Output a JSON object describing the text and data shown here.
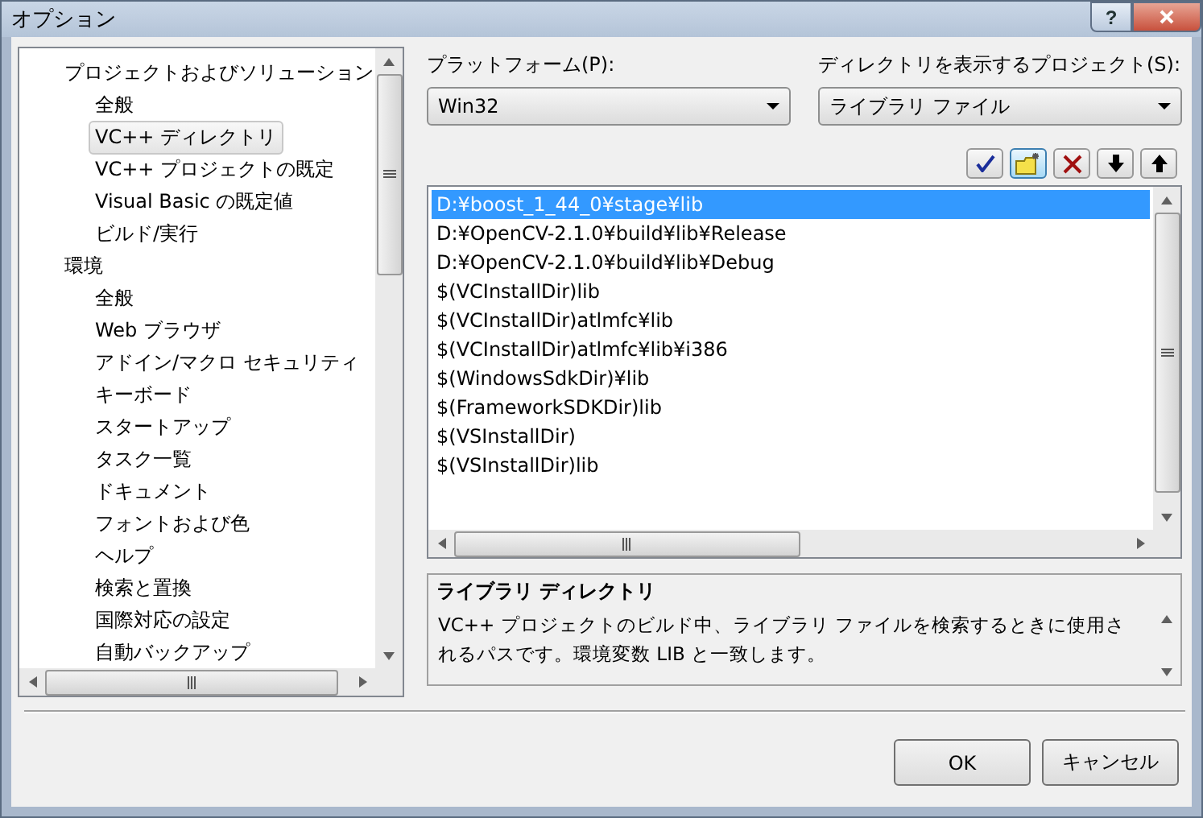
{
  "window": {
    "title": "オプション",
    "help": "?"
  },
  "tree": [
    {
      "label": "プロジェクトおよびソリューション",
      "selected": false,
      "children": [
        {
          "label": "全般",
          "selected": false
        },
        {
          "label": "VC++ ディレクトリ",
          "selected": true
        },
        {
          "label": "VC++ プロジェクトの既定",
          "selected": false
        },
        {
          "label": "Visual Basic の既定値",
          "selected": false
        },
        {
          "label": "ビルド/実行",
          "selected": false
        }
      ]
    },
    {
      "label": "環境",
      "selected": false,
      "children": [
        {
          "label": "全般",
          "selected": false
        },
        {
          "label": "Web ブラウザ",
          "selected": false
        },
        {
          "label": "アドイン/マクロ セキュリティ",
          "selected": false
        },
        {
          "label": "キーボード",
          "selected": false
        },
        {
          "label": "スタートアップ",
          "selected": false
        },
        {
          "label": "タスク一覧",
          "selected": false
        },
        {
          "label": "ドキュメント",
          "selected": false
        },
        {
          "label": "フォントおよび色",
          "selected": false
        },
        {
          "label": "ヘルプ",
          "selected": false
        },
        {
          "label": "検索と置換",
          "selected": false
        },
        {
          "label": "国際対応の設定",
          "selected": false
        },
        {
          "label": "自動バックアップ",
          "selected": false
        }
      ]
    }
  ],
  "platform": {
    "label": "プラットフォーム(P):",
    "value": "Win32"
  },
  "project": {
    "label": "ディレクトリを表示するプロジェクト(S):",
    "value": "ライブラリ ファイル"
  },
  "toolbar": [
    {
      "kind": "check"
    },
    {
      "kind": "folder"
    },
    {
      "kind": "delete"
    },
    {
      "kind": "down"
    },
    {
      "kind": "up"
    }
  ],
  "directories": [
    {
      "path": "D:¥boost_1_44_0¥stage¥lib",
      "selected": true
    },
    {
      "path": "D:¥OpenCV-2.1.0¥build¥lib¥Release",
      "selected": false
    },
    {
      "path": "D:¥OpenCV-2.1.0¥build¥lib¥Debug",
      "selected": false
    },
    {
      "path": "$(VCInstallDir)lib",
      "selected": false
    },
    {
      "path": "$(VCInstallDir)atlmfc¥lib",
      "selected": false
    },
    {
      "path": "$(VCInstallDir)atlmfc¥lib¥i386",
      "selected": false
    },
    {
      "path": "$(WindowsSdkDir)¥lib",
      "selected": false
    },
    {
      "path": "$(FrameworkSDKDir)lib",
      "selected": false
    },
    {
      "path": "$(VSInstallDir)",
      "selected": false
    },
    {
      "path": "$(VSInstallDir)lib",
      "selected": false
    }
  ],
  "description": {
    "title": "ライブラリ ディレクトリ",
    "text": "VC++ プロジェクトのビルド中、ライブラリ ファイルを検索するときに使用されるパスです。環境変数 LIB と一致します。"
  },
  "buttons": [
    "OK",
    "キャンセル"
  ]
}
